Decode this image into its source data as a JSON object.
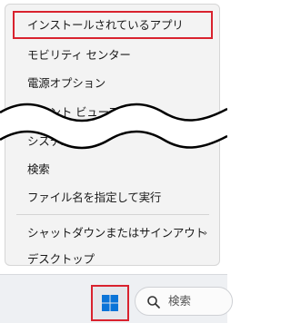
{
  "context_menu": {
    "items": [
      {
        "label": "インストールされているアプリ",
        "highlighted": true
      },
      {
        "label": "モビリティ センター"
      },
      {
        "label": "電源オプション"
      },
      {
        "label": "イベント ビューアー"
      },
      {
        "label": "システム"
      },
      {
        "label": "検索"
      },
      {
        "label": "ファイル名を指定して実行"
      },
      {
        "label": "シャットダウンまたはサインアウト",
        "submenu_arrow": "›"
      },
      {
        "label": "デスクトップ"
      }
    ]
  },
  "taskbar": {
    "start_icon": "windows-logo-icon",
    "search_icon": "search-icon",
    "search_placeholder": "検索"
  },
  "colors": {
    "highlight": "#d9222e",
    "windows_blue": "#0a74d8",
    "menu_background": "#f3f3f3"
  }
}
